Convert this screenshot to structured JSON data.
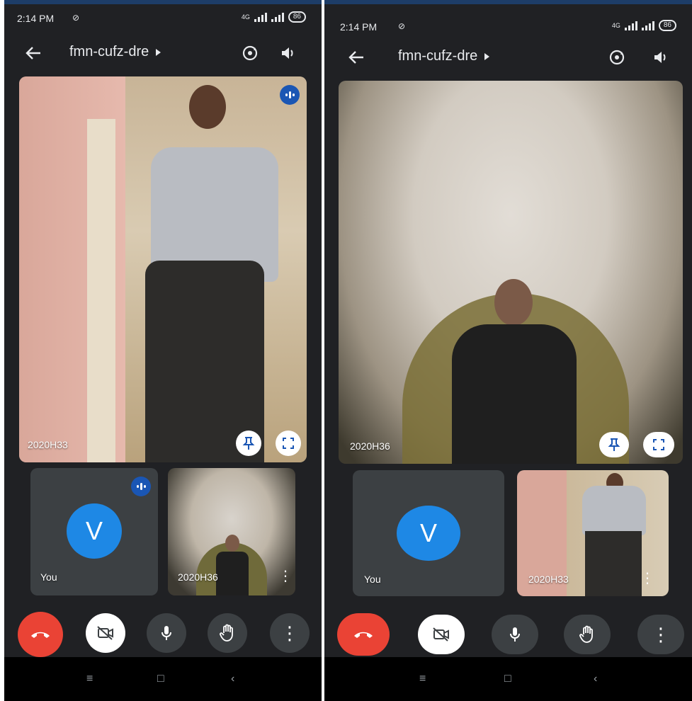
{
  "status_bar": {
    "time": "2:14 PM",
    "battery": "86",
    "network": "4G"
  },
  "meeting": {
    "code": "fmn-cufz-dre"
  },
  "icons": {
    "back": "back-arrow-icon",
    "switch_camera": "switch-camera-icon",
    "audio": "speaker-icon",
    "pin": "pin-icon",
    "fullscreen": "fullscreen-icon",
    "speaking": "speaking-indicator-icon",
    "end_call": "end-call-icon",
    "camera_off": "camera-off-icon",
    "mic": "microphone-icon",
    "raise_hand": "raise-hand-icon",
    "more": "more-vertical-icon"
  },
  "left": {
    "main_tile": {
      "participant": "2020H33"
    },
    "self_tile": {
      "avatar_letter": "V",
      "label": "You"
    },
    "thumb_tile": {
      "participant": "2020H36"
    }
  },
  "right": {
    "main_tile": {
      "participant": "2020H36"
    },
    "self_tile": {
      "avatar_letter": "V",
      "label": "You"
    },
    "thumb_tile": {
      "participant": "2020H33"
    }
  },
  "nav": {
    "menu": "≡",
    "home": "□",
    "back": "‹"
  },
  "colors": {
    "end_call": "#ea4335",
    "avatar": "#1e88e5",
    "speaking": "#1a56b4",
    "background": "#202124"
  }
}
